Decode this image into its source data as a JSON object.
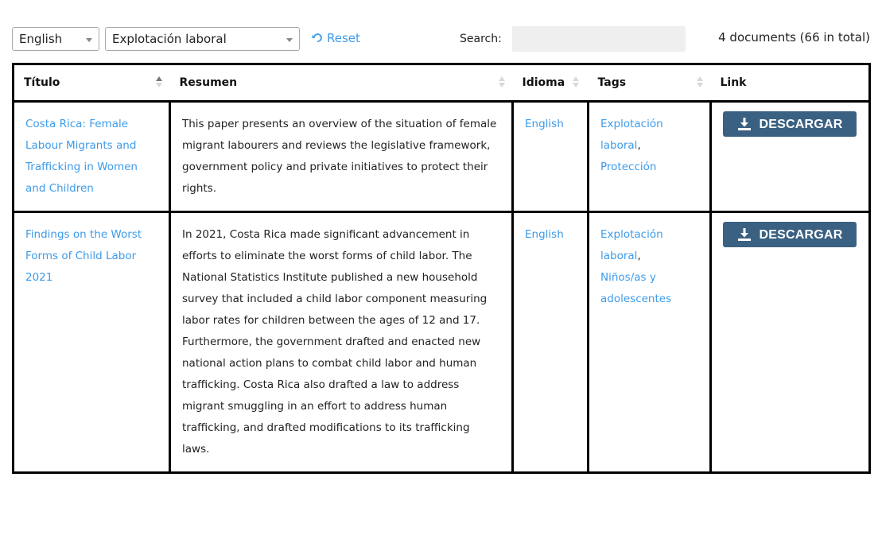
{
  "filters": {
    "language": {
      "selected": "English"
    },
    "tag": {
      "selected": "Explotación laboral"
    },
    "reset_label": "Reset"
  },
  "search": {
    "label": "Search:",
    "value": "",
    "placeholder": ""
  },
  "count_text": "4 documents (66 in total)",
  "table": {
    "columns": [
      {
        "label": "Título",
        "sort": "asc"
      },
      {
        "label": "Resumen",
        "sort": "none"
      },
      {
        "label": "Idioma",
        "sort": "none"
      },
      {
        "label": "Tags",
        "sort": "none"
      },
      {
        "label": "Link",
        "sort": null
      }
    ],
    "rows": [
      {
        "title": "Costa Rica: Female Labour Migrants and Trafficking in Women and Children",
        "summary": "This paper presents an overview of the situation of female migrant labourers and reviews the legislative framework, government policy and private initiatives to protect their rights.",
        "language": "English",
        "tags": [
          "Explotación laboral",
          "Protección"
        ],
        "download_label": "DESCARGAR"
      },
      {
        "title": "Findings on the Worst Forms of Child Labor 2021",
        "summary": "In 2021, Costa Rica made significant advancement in efforts to eliminate the worst forms of child labor. The National Statistics Institute published a new household survey that included a child labor component measuring labor rates for children between the ages of 12 and 17. Furthermore, the government drafted and enacted new national action plans to combat child labor and human trafficking. Costa Rica also drafted a law to address migrant smuggling in an effort to address human trafficking, and drafted modifications to its trafficking laws.",
        "language": "English",
        "tags": [
          "Explotación laboral",
          "Niños/as y adolescentes"
        ],
        "download_label": "DESCARGAR"
      }
    ]
  },
  "colors": {
    "link": "#3d9be9",
    "button": "#3b6182",
    "border": "#000000"
  }
}
